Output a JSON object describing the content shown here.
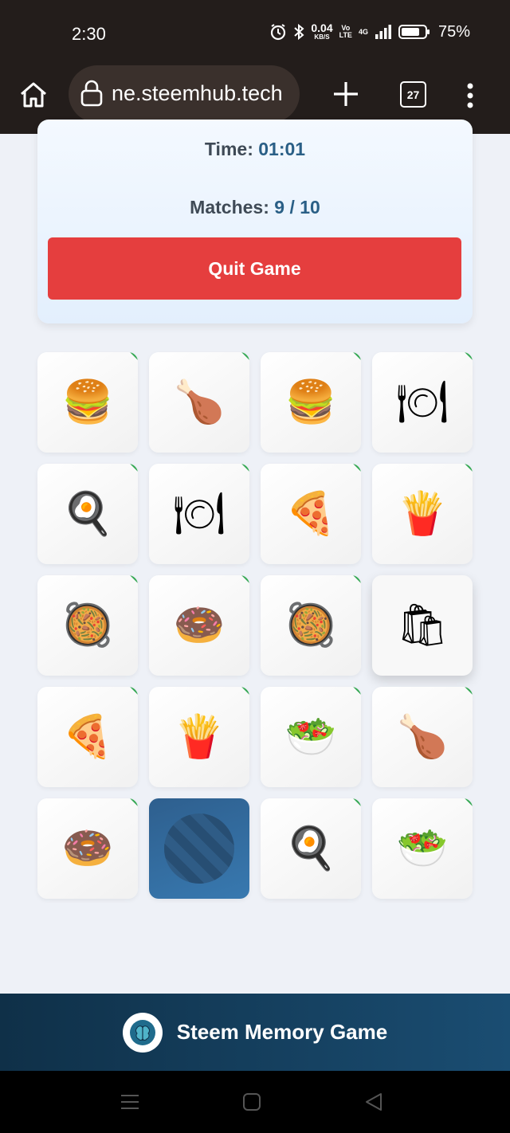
{
  "status_bar": {
    "time": "2:30",
    "net_speed_value": "0.04",
    "net_speed_unit": "KB/S",
    "volte_top": "Vo",
    "volte_bottom": "LTE",
    "network_type": "4G",
    "battery_percent": "75%"
  },
  "browser": {
    "url": "ne.steemhub.tech",
    "tab_count": "27"
  },
  "game": {
    "time_label": "Time:",
    "time_value": "01:01",
    "matches_label": "Matches:",
    "matches_value": "9 / 10",
    "quit_label": "Quit Game"
  },
  "cards": [
    {
      "icon": "fast-food-combo",
      "glyph": "🍔",
      "state": "matched"
    },
    {
      "icon": "roast-chicken",
      "glyph": "🍗",
      "state": "matched"
    },
    {
      "icon": "fast-food-combo",
      "glyph": "🍔",
      "state": "matched"
    },
    {
      "icon": "plate-cutlery",
      "glyph": "🍽",
      "state": "matched"
    },
    {
      "icon": "breakfast-plate",
      "glyph": "🍳",
      "state": "matched"
    },
    {
      "icon": "plate-cutlery",
      "glyph": "🍽",
      "state": "matched"
    },
    {
      "icon": "pizza",
      "glyph": "🍕",
      "state": "matched"
    },
    {
      "icon": "burger-fries-drink",
      "glyph": "🍟",
      "state": "matched"
    },
    {
      "icon": "frying-pan-breakfast",
      "glyph": "🥘",
      "state": "matched"
    },
    {
      "icon": "donut",
      "glyph": "🍩",
      "state": "matched"
    },
    {
      "icon": "frying-pan-breakfast",
      "glyph": "🥘",
      "state": "matched"
    },
    {
      "icon": "takeaway-bag",
      "glyph": "🛍",
      "state": "selected"
    },
    {
      "icon": "pizza",
      "glyph": "🍕",
      "state": "matched"
    },
    {
      "icon": "burger-fries-drink",
      "glyph": "🍟",
      "state": "matched"
    },
    {
      "icon": "healthy-groceries",
      "glyph": "🥗",
      "state": "matched"
    },
    {
      "icon": "roast-chicken",
      "glyph": "🍗",
      "state": "matched"
    },
    {
      "icon": "donut",
      "glyph": "🍩",
      "state": "matched"
    },
    {
      "icon": "card-back",
      "glyph": "",
      "state": "facedown"
    },
    {
      "icon": "breakfast-plate",
      "glyph": "🍳",
      "state": "matched"
    },
    {
      "icon": "healthy-groceries",
      "glyph": "🥗",
      "state": "matched"
    }
  ],
  "footer": {
    "title": "Steem Memory Game",
    "logo_icon": "brain-icon"
  },
  "colors": {
    "quit_button": "#e53e3e",
    "stat_value": "#2a5f86",
    "matched_marker": "#34a853",
    "card_back": "#3879b0",
    "footer_bg": "#1a4d72"
  }
}
